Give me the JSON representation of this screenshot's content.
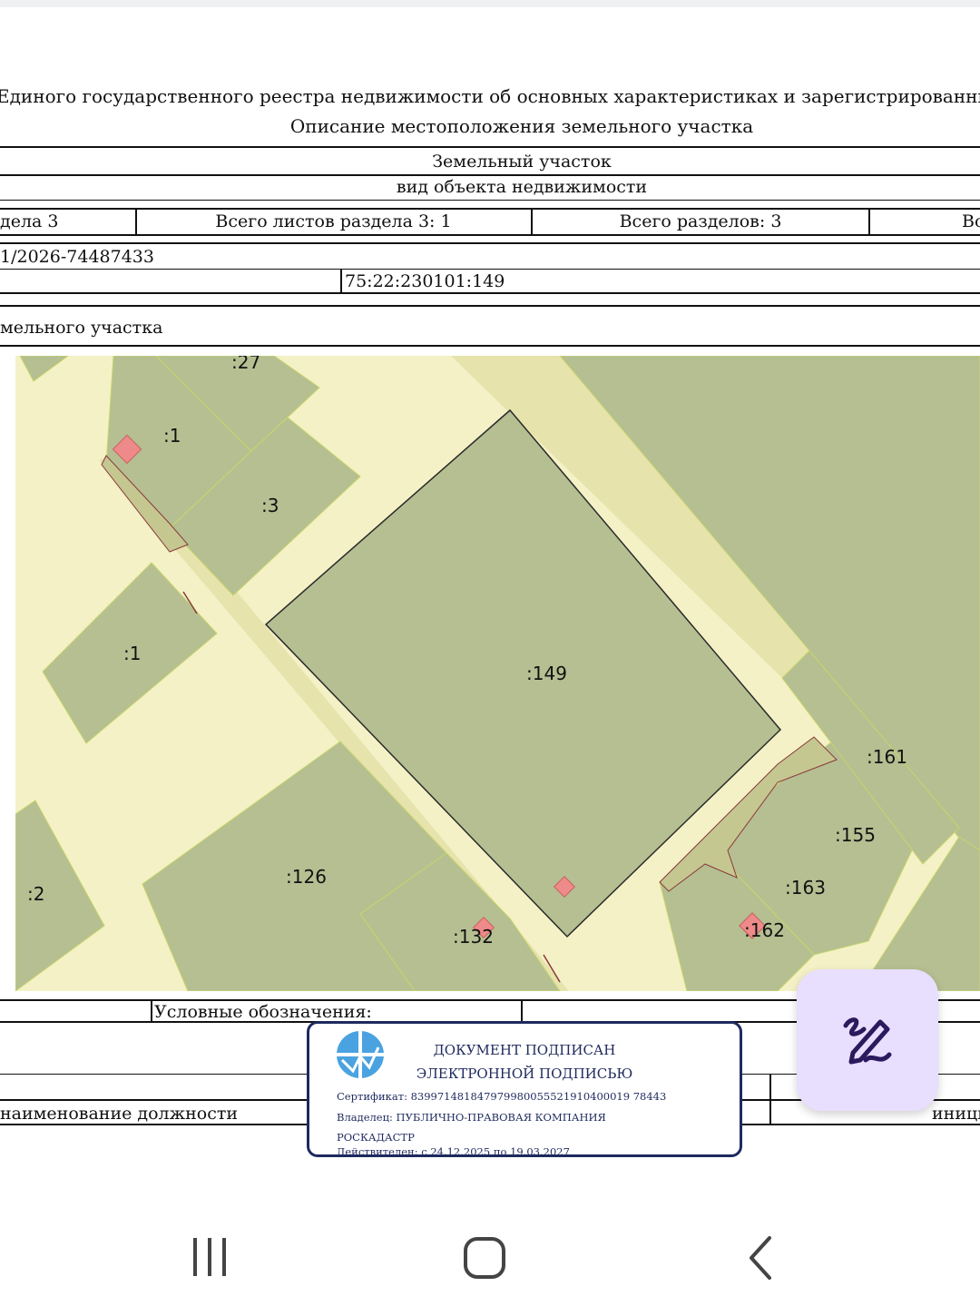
{
  "header": {
    "line1": "Единого государственного реестра недвижимости об основных характеристиках и зарегистрированных правах на об",
    "line2": "Описание местоположения земельного участка"
  },
  "table": {
    "object_type": "Земельный участок",
    "object_type_caption": "вид объекта недвижимости",
    "section_cell": "дела 3",
    "sheets_cell": "Всего листов раздела 3: 1",
    "sections_cell": "Всего разделов: 3",
    "last_cell": "Во",
    "record_number": "1/2026-74487433",
    "cadastral_number": "75:22:230101:149",
    "plan_caption": "мельного участка"
  },
  "map_labels": {
    "l27": ":27",
    "l1a": ":1",
    "l3": ":3",
    "l1b": ":1",
    "l149": ":149",
    "l161": ":161",
    "l155": ":155",
    "l163": ":163",
    "l126": ":126",
    "l2": ":2",
    "l132": ":132",
    "l162": ":162"
  },
  "footer": {
    "legend": "Условные обозначения:",
    "position_name": "наименование должности",
    "initials": "иници"
  },
  "stamp": {
    "title1": "ДОКУМЕНТ ПОДПИСАН",
    "title2": "ЭЛЕКТРОННОЙ ПОДПИСЬЮ",
    "certificate": "Сертификат: 839971481847979980055521910400019 78443",
    "owner_line1": "Владелец: ПУБЛИЧНО-ПРАВОВАЯ КОМПАНИЯ",
    "owner_line2": "РОСКАДАСТР",
    "valid": "Действителен: с 24.12.2025 по 19.03.2027"
  },
  "icons": {
    "fab": "signature-pen-icon",
    "nav_recent": "recent-apps-icon",
    "nav_home": "home-icon",
    "nav_back": "back-icon"
  },
  "colors": {
    "parcel": "#b5bf92",
    "road": "#f4f1c6",
    "building": "#ee8a8a",
    "stamp_border": "#1e2a5e",
    "fab_bg": "#e8defe"
  }
}
